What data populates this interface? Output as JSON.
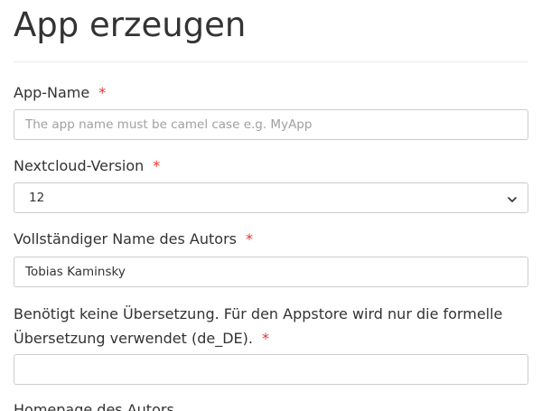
{
  "page": {
    "title": "App erzeugen"
  },
  "form": {
    "app_name": {
      "label": "App-Name",
      "required_mark": "*",
      "value": "",
      "placeholder": "The app name must be camel case e.g. MyApp"
    },
    "nextcloud_version": {
      "label": "Nextcloud-Version",
      "required_mark": "*",
      "selected": "12"
    },
    "author_name": {
      "label": "Vollständiger Name des Autors",
      "required_mark": "*",
      "value": "Tobias Kaminsky",
      "placeholder": ""
    },
    "translation_note": {
      "label": "Benötigt keine Übersetzung. Für den Appstore wird nur die formelle Übersetzung verwendet (de_DE).",
      "required_mark": "*",
      "value": "",
      "placeholder": ""
    },
    "author_homepage": {
      "label": "Homepage des Autors"
    }
  },
  "icons": {
    "select_chevron": "chevron-down-icon"
  },
  "colors": {
    "required": "#e9322d",
    "border": "#cccccc",
    "text": "#333333",
    "placeholder": "#a0a0a0"
  }
}
